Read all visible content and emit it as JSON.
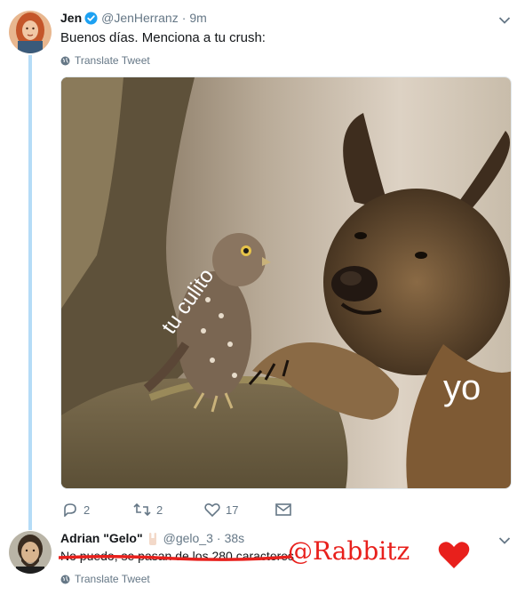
{
  "tweet": {
    "author_name": "Jen",
    "author_handle": "@JenHerranz",
    "time": "9m",
    "text": "Buenos días. Menciona a tu crush:",
    "translate_label": "Translate Tweet",
    "media": {
      "caption_left": "tu culito",
      "caption_right": "yo"
    },
    "actions": {
      "replies": "2",
      "retweets": "2",
      "likes": "17"
    }
  },
  "reply": {
    "author_name": "Adrian \"Gelo\"",
    "author_handle": "@gelo_3",
    "time": "38s",
    "text": "No puedo, se pasan de los 280 caracteres",
    "handwritten": "@Rabbitz",
    "translate_label": "Translate Tweet"
  },
  "colors": {
    "accent": "#1da1f2",
    "thread_line": "#b5dcf7",
    "strike_red": "#e8201c"
  },
  "separator": "·"
}
